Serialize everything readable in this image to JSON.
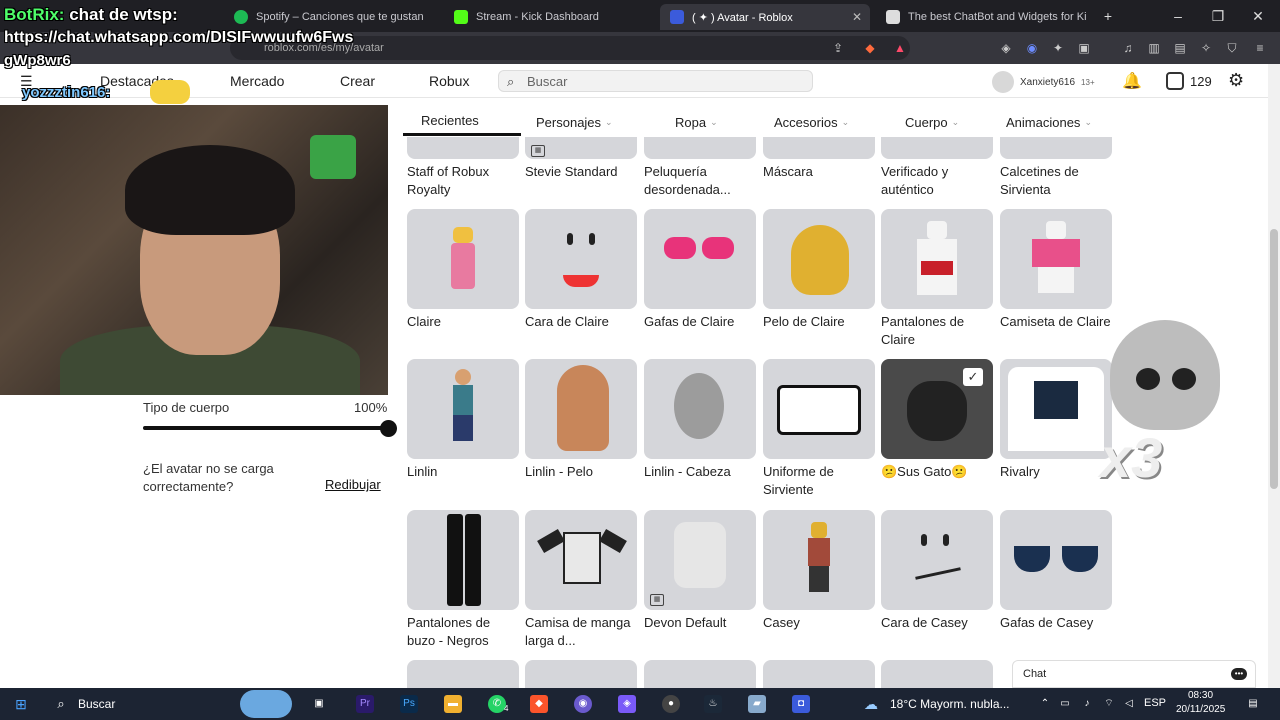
{
  "browser": {
    "tabs": [
      {
        "label": "Spotify – Canciones que te gustan",
        "color": "#1db954"
      },
      {
        "label": "Stream - Kick Dashboard",
        "color": "#53fc18"
      },
      {
        "label": "( ✦ ) Avatar - Roblox",
        "color": "#3b5bdb",
        "active": true
      },
      {
        "label": "The best ChatBot and Widgets for Ki",
        "color": "#e0e0e0"
      }
    ],
    "new_tab": "+",
    "url": "roblox.com/es/my/avatar",
    "window_controls": [
      "–",
      "❐",
      "✕"
    ]
  },
  "header": {
    "nav": [
      "Destacadas",
      "Mercado",
      "Crear",
      "Robux"
    ],
    "search_placeholder": "Buscar",
    "username": "Xanxiety616",
    "age_badge": "13+",
    "robux_count": "129"
  },
  "overlays": {
    "botrix_prefix": "BotRix:",
    "botrix_message": "chat de wtsp:",
    "whatsapp_link": "https://chat.whatsapp.com/DISIFwwuufw6Fws",
    "whatsapp_link_2": "gWp8wr6",
    "chat_user": "yozzztin616:"
  },
  "avatar_panel": {
    "body_type_label": "Tipo de cuerpo",
    "body_type_value": "100%",
    "body_type_fraction": 1.0,
    "reload_question": "¿El avatar no se carga correctamente?",
    "redraw": "Redibujar"
  },
  "categories": [
    {
      "label": "Recientes",
      "active": true
    },
    {
      "label": "Personajes"
    },
    {
      "label": "Ropa"
    },
    {
      "label": "Accesorios"
    },
    {
      "label": "Cuerpo"
    },
    {
      "label": "Animaciones"
    }
  ],
  "items": {
    "row0": [
      "Staff of Robux Royalty",
      "Stevie Standard",
      "Peluquería desordenada...",
      "Máscara",
      "Verificado y auténtico",
      "Calcetines de Sirvienta"
    ],
    "row1": [
      "Claire",
      "Cara de Claire",
      "Gafas de Claire",
      "Pelo de Claire",
      "Pantalones de Claire",
      "Camiseta de Claire"
    ],
    "row2": [
      "Linlin",
      "Linlin - Pelo",
      "Linlin - Cabeza",
      "Uniforme de Sirviente",
      "😕Sus Gato😕",
      "Rivalry"
    ],
    "row3": [
      "Pantalones de buzo - Negros",
      "Camisa de manga larga d...",
      "Devon Default",
      "Casey",
      "Cara de Casey",
      "Gafas de Casey"
    ]
  },
  "stream_overlay": {
    "multiplier": "x3"
  },
  "chat": {
    "label": "Chat"
  },
  "taskbar": {
    "search": "Buscar",
    "weather": "18°C  Mayorm. nubla...",
    "language": "ESP",
    "time": "08:30",
    "date": "20/11/2025",
    "notification_count": "4"
  }
}
